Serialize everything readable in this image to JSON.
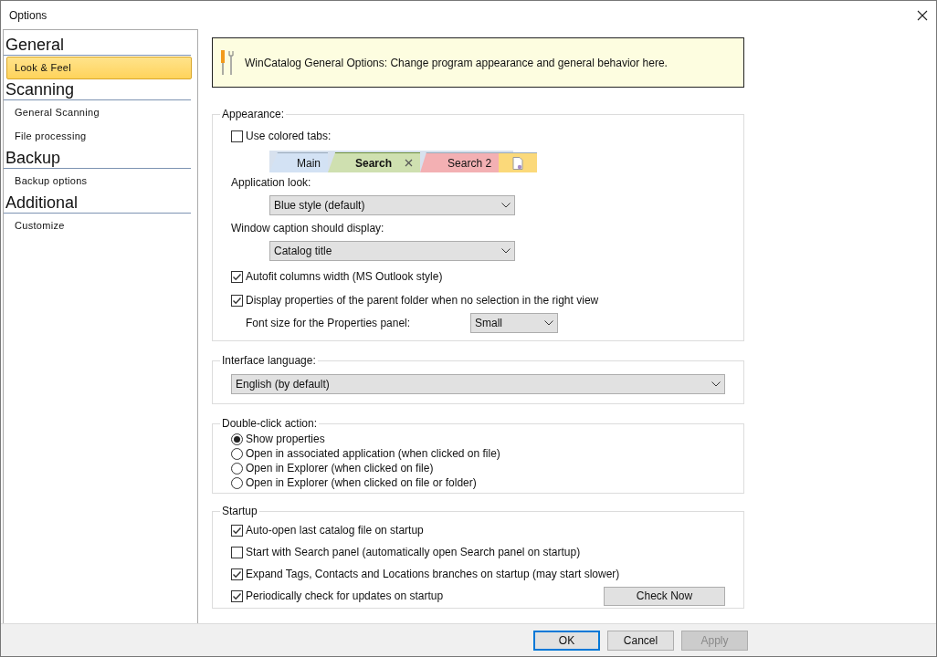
{
  "window": {
    "title": "Options"
  },
  "sidebar": {
    "groups": [
      {
        "title": "General",
        "items": [
          {
            "label": "Look & Feel",
            "selected": true
          }
        ]
      },
      {
        "title": "Scanning",
        "items": [
          {
            "label": "General Scanning",
            "selected": false
          },
          {
            "label": "File processing",
            "selected": false
          }
        ]
      },
      {
        "title": "Backup",
        "items": [
          {
            "label": "Backup options",
            "selected": false
          }
        ]
      },
      {
        "title": "Additional",
        "items": [
          {
            "label": "Customize",
            "selected": false
          }
        ]
      }
    ]
  },
  "banner": {
    "text": "WinCatalog General Options: Change program appearance and general behavior here."
  },
  "appearance": {
    "title": "Appearance:",
    "use_colored_tabs": {
      "label": "Use colored tabs:",
      "checked": false
    },
    "tab_preview": [
      {
        "kind": "text",
        "label": "Main",
        "color": "#d3e2f4",
        "selected": false,
        "closable": false
      },
      {
        "kind": "text",
        "label": "Search",
        "color": "#cfe0b0",
        "selected": true,
        "closable": true
      },
      {
        "kind": "text",
        "label": "Search 2",
        "color": "#f3b0b3",
        "selected": false,
        "closable": false
      },
      {
        "kind": "icon",
        "color": "#fbd97a",
        "selected": false,
        "closable": false
      }
    ],
    "application_look": {
      "label": "Application look:",
      "value": "Blue style (default)"
    },
    "window_caption": {
      "label": "Window caption should display:",
      "value": "Catalog title"
    },
    "options": [
      {
        "label": "Autofit columns width (MS Outlook style)",
        "checked": true
      },
      {
        "label": "Display properties of the parent folder when no selection in the right view",
        "checked": true
      }
    ],
    "font_size": {
      "label": "Font size for the Properties panel:",
      "value": "Small"
    }
  },
  "interface_language": {
    "title": "Interface language:",
    "value": "English (by default)"
  },
  "double_click_action": {
    "title": "Double-click action:",
    "options": [
      {
        "label": "Show properties",
        "selected": true
      },
      {
        "label": "Open in associated application (when clicked on file)",
        "selected": false
      },
      {
        "label": "Open in Explorer (when clicked on file)",
        "selected": false
      },
      {
        "label": "Open in Explorer (when clicked on file or folder)",
        "selected": false
      }
    ]
  },
  "startup": {
    "title": "Startup",
    "options": [
      {
        "label": "Auto-open last catalog file on startup",
        "checked": true
      },
      {
        "label": "Start with Search panel (automatically open Search panel on startup)",
        "checked": false
      },
      {
        "label": "Expand Tags, Contacts and Locations branches on startup (may start slower)",
        "checked": true
      },
      {
        "label": "Periodically check for updates on startup",
        "checked": true
      }
    ],
    "check_now_button": "Check Now"
  },
  "buttons": [
    {
      "label": "OK",
      "default": true,
      "disabled": false
    },
    {
      "label": "Cancel",
      "default": false,
      "disabled": false
    },
    {
      "label": "Apply",
      "default": false,
      "disabled": true
    }
  ]
}
